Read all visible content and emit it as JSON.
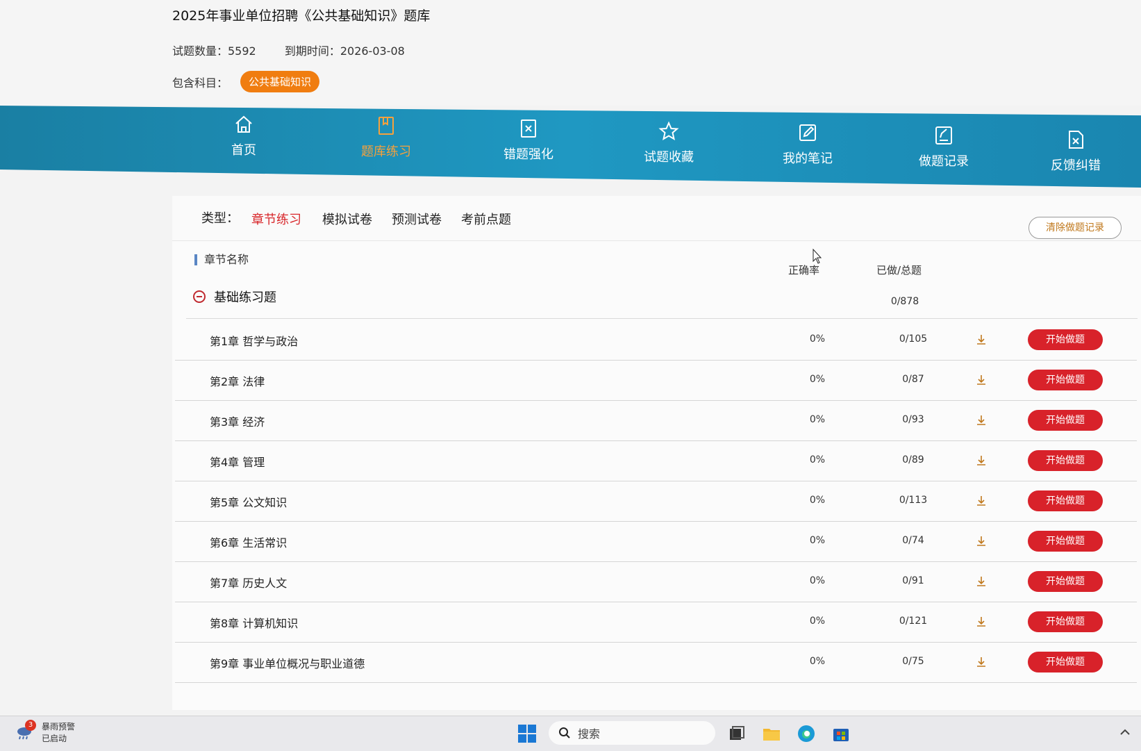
{
  "header": {
    "title": "2025年事业单位招聘《公共基础知识》题库",
    "question_count": "试题数量：5592",
    "expiry": "到期时间：2026-03-08",
    "subjects_label": "包含科目：",
    "subject_tag": "公共基础知识"
  },
  "nav": {
    "items": [
      {
        "label": "首页",
        "icon": "home-icon"
      },
      {
        "label": "题库练习",
        "icon": "book-icon",
        "active": true
      },
      {
        "label": "错题强化",
        "icon": "wrong-questions-icon"
      },
      {
        "label": "试题收藏",
        "icon": "star-icon"
      },
      {
        "label": "我的笔记",
        "icon": "edit-note-icon"
      },
      {
        "label": "做题记录",
        "icon": "record-icon"
      },
      {
        "label": "反馈纠错",
        "icon": "feedback-icon"
      }
    ]
  },
  "types": {
    "label": "类型：",
    "tabs": [
      "章节练习",
      "模拟试卷",
      "预测试卷",
      "考前点题"
    ],
    "active": 0,
    "clear_button": "清除做题记录"
  },
  "table": {
    "col_chapter": "章节名称",
    "col_accuracy": "正确率",
    "col_progress": "已做/总题",
    "group": {
      "name": "基础练习题",
      "progress": "0/878"
    },
    "start_label": "开始做题",
    "rows": [
      {
        "name": "第1章 哲学与政治",
        "rate": "0%",
        "progress": "0/105"
      },
      {
        "name": "第2章 法律",
        "rate": "0%",
        "progress": "0/87"
      },
      {
        "name": "第3章 经济",
        "rate": "0%",
        "progress": "0/93"
      },
      {
        "name": "第4章 管理",
        "rate": "0%",
        "progress": "0/89"
      },
      {
        "name": "第5章 公文知识",
        "rate": "0%",
        "progress": "0/113"
      },
      {
        "name": "第6章 生活常识",
        "rate": "0%",
        "progress": "0/74"
      },
      {
        "name": "第7章 历史人文",
        "rate": "0%",
        "progress": "0/91"
      },
      {
        "name": "第8章 计算机知识",
        "rate": "0%",
        "progress": "0/121"
      },
      {
        "name": "第9章 事业单位概况与职业道德",
        "rate": "0%",
        "progress": "0/75"
      }
    ]
  },
  "taskbar": {
    "weather_badge": "3",
    "weather_line1": "暴雨预警",
    "weather_line2": "已启动",
    "search_placeholder": "搜索"
  },
  "colors": {
    "nav_bg": "#1f98c2",
    "active_nav": "#f7a13b",
    "start_button": "#d8222a",
    "subject_tag": "#f07d10",
    "active_tab": "#d8272b"
  }
}
